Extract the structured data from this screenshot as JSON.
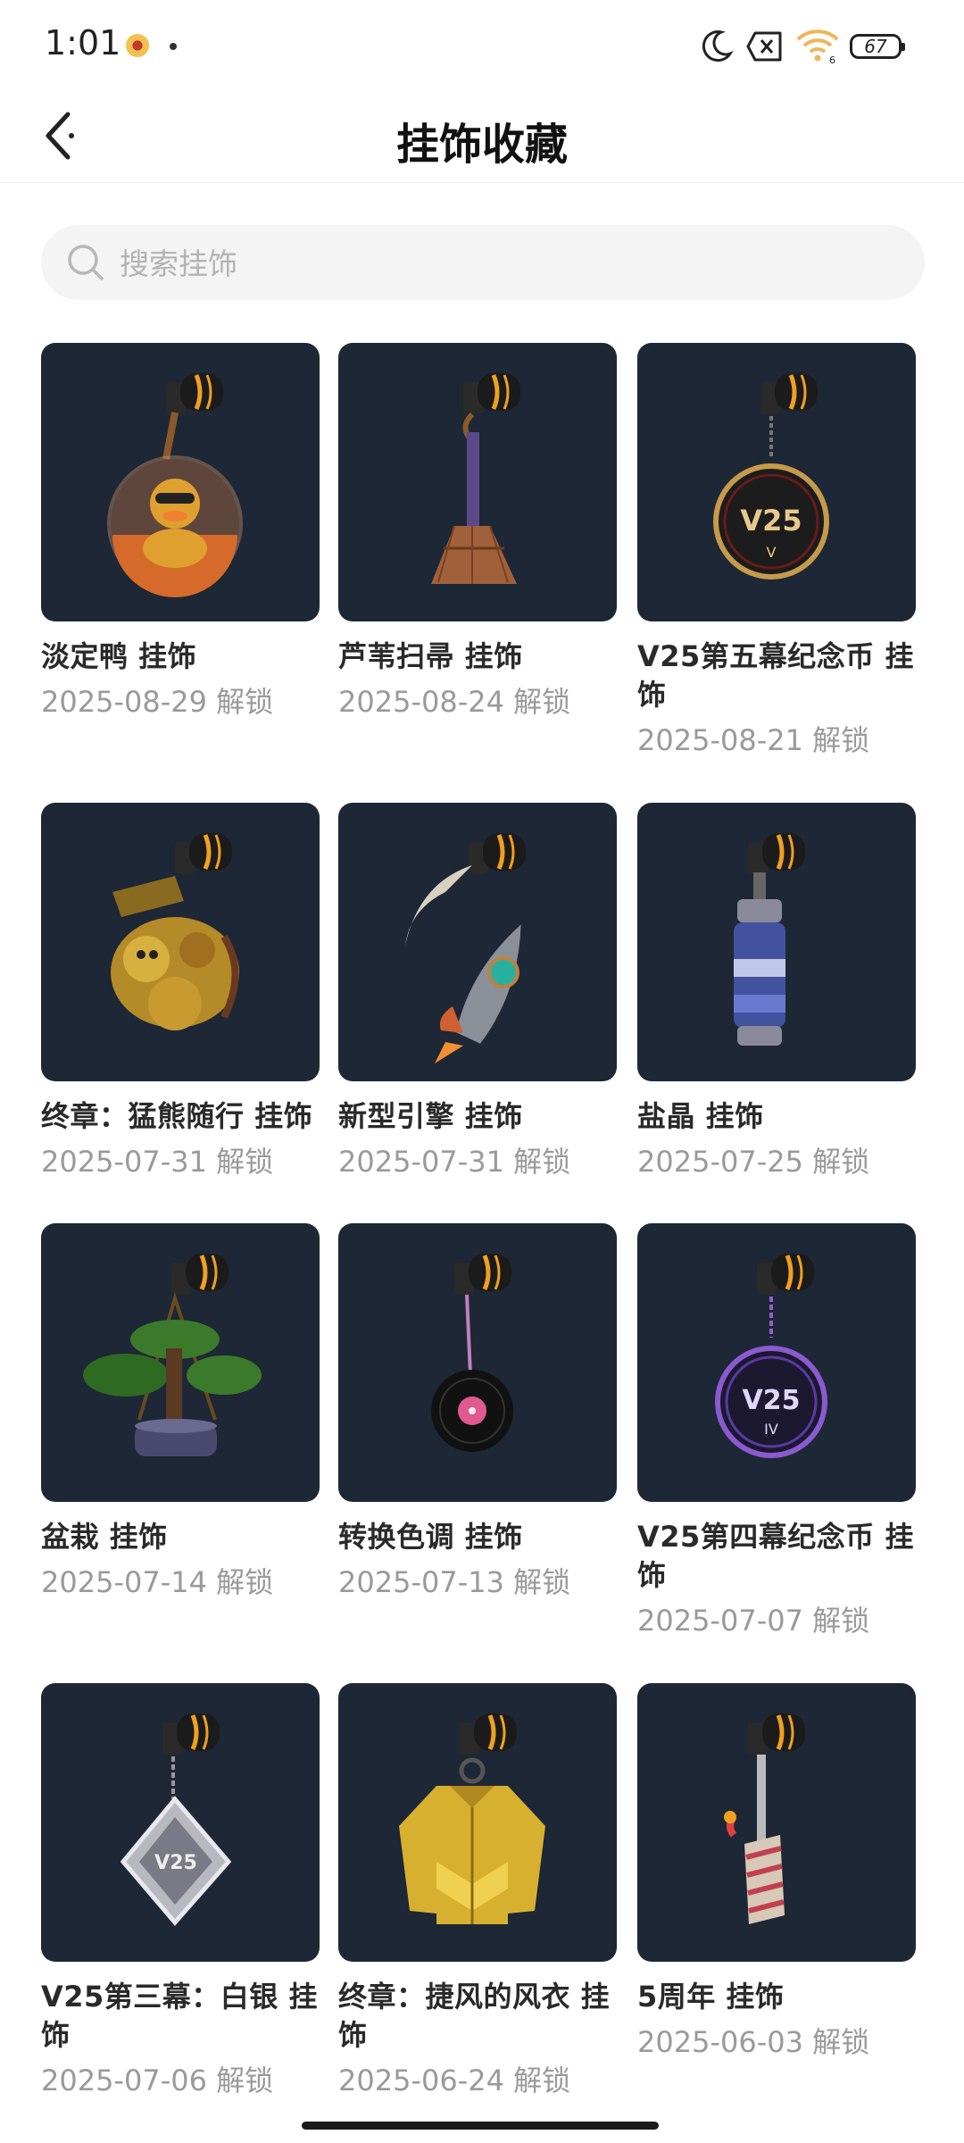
{
  "status_bar": {
    "time": "1:01",
    "battery": "67"
  },
  "header": {
    "title": "挂饰收藏"
  },
  "search": {
    "placeholder": "搜索挂饰",
    "value": ""
  },
  "items": [
    {
      "name": "淡定鸭 挂饰",
      "date": "2025-08-29 解锁",
      "icon": "duck-charm-icon"
    },
    {
      "name": "芦苇扫帚 挂饰",
      "date": "2025-08-24 解锁",
      "icon": "broom-charm-icon"
    },
    {
      "name": "V25第五幕纪念币 挂饰",
      "date": "2025-08-21 解锁",
      "icon": "v25-coin-charm-icon"
    },
    {
      "name": "终章：猛熊随行 挂饰",
      "date": "2025-07-31 解锁",
      "icon": "golden-bear-charm-icon"
    },
    {
      "name": "新型引擎 挂饰",
      "date": "2025-07-31 解锁",
      "icon": "rocket-charm-icon"
    },
    {
      "name": "盐晶 挂饰",
      "date": "2025-07-25 解锁",
      "icon": "salt-crystal-charm-icon"
    },
    {
      "name": "盆栽 挂饰",
      "date": "2025-07-14 解锁",
      "icon": "bonsai-charm-icon"
    },
    {
      "name": "转换色调 挂饰",
      "date": "2025-07-13 解锁",
      "icon": "vinyl-record-charm-icon"
    },
    {
      "name": "V25第四幕纪念币 挂饰",
      "date": "2025-07-07 解锁",
      "icon": "v25-iv-coin-charm-icon"
    },
    {
      "name": "V25第三幕：白银 挂饰",
      "date": "2025-07-06 解锁",
      "icon": "silver-diamond-charm-icon"
    },
    {
      "name": "终章：捷风的风衣 挂饰",
      "date": "2025-06-24 解锁",
      "icon": "jacket-charm-icon"
    },
    {
      "name": "5周年 挂饰",
      "date": "2025-06-03 解锁",
      "icon": "cake-charm-icon"
    }
  ],
  "colors": {
    "thumb_bg": "#1d2735",
    "accent_gold": "#f0a020"
  }
}
